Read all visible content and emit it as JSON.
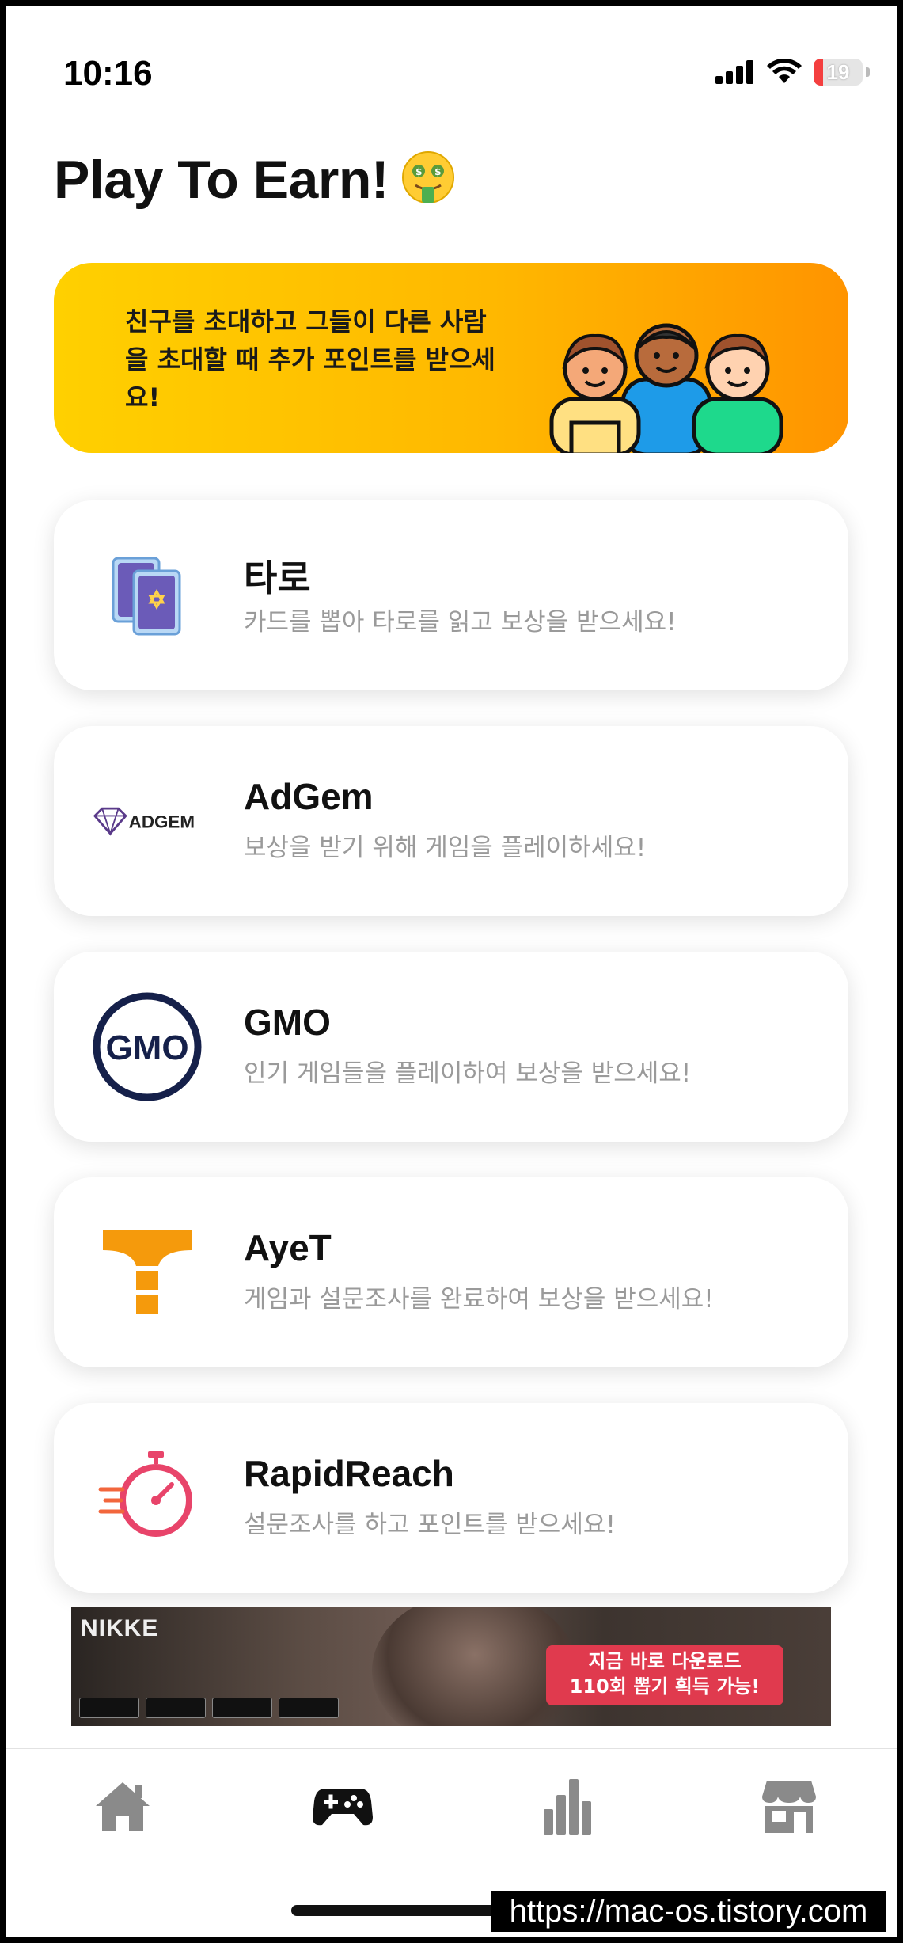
{
  "status_bar": {
    "time": "10:16",
    "battery_level": "19"
  },
  "header": {
    "title": "Play To Earn!",
    "emoji_icon": "money-mouth-face-icon"
  },
  "promo": {
    "text": "친구를 초대하고 그들이 다른 사람을 초대할 때 추가 포인트를 받으세요!",
    "art_icon": "friends-group-icon"
  },
  "offers": [
    {
      "title": "타로",
      "subtitle": "카드를 뽑아 타로를 읽고 보상을 받으세요!",
      "icon": "tarot-cards-icon"
    },
    {
      "title": "AdGem",
      "subtitle": "보상을 받기 위해 게임을 플레이하세요!",
      "icon": "adgem-logo",
      "logo_text": "ADGEM"
    },
    {
      "title": "GMO",
      "subtitle": "인기 게임들을 플레이하여 보상을 받으세요!",
      "icon": "gmo-logo",
      "logo_text": "GMO"
    },
    {
      "title": "AyeT",
      "subtitle": "게임과 설문조사를 완료하여 보상을 받으세요!",
      "icon": "ayet-logo"
    },
    {
      "title": "RapidReach",
      "subtitle": "설문조사를 하고 포인트를 받으세요!",
      "icon": "stopwatch-icon"
    }
  ],
  "ad": {
    "brand": "NIKKE",
    "cta": "지금 바로 다운로드\n110회 뽑기 획득 가능!"
  },
  "tabs": [
    {
      "name": "home",
      "icon": "home-icon"
    },
    {
      "name": "games",
      "icon": "gamepad-icon",
      "active": true
    },
    {
      "name": "stats",
      "icon": "bar-chart-icon"
    },
    {
      "name": "store",
      "icon": "store-icon"
    }
  ],
  "watermark": "https://mac-os.tistory.com",
  "colors": {
    "accent": "#ffb800",
    "active_tab": "#111111",
    "inactive_tab": "#8a8a8a"
  }
}
